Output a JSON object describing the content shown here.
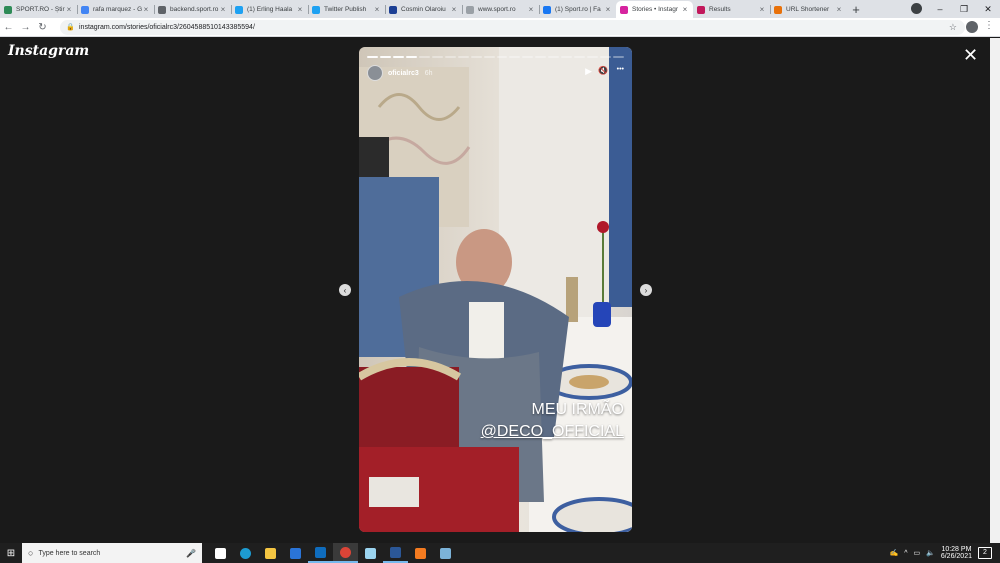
{
  "browser": {
    "tabs": [
      {
        "title": "SPORT.RO - Știri",
        "favicon_color": "#2e8b57",
        "active": false
      },
      {
        "title": "rafa marquez - G",
        "favicon_color": "#4285f4",
        "active": false
      },
      {
        "title": "backend.sport.ro",
        "favicon_color": "#5f6368",
        "active": false
      },
      {
        "title": "(1) Erling Haala",
        "favicon_color": "#1da1f2",
        "active": false
      },
      {
        "title": "Twitter Publish",
        "favicon_color": "#1da1f2",
        "active": false
      },
      {
        "title": "Cosmin Olaroiu",
        "favicon_color": "#1c3f94",
        "active": false
      },
      {
        "title": "www.sport.ro",
        "favicon_color": "#9aa0a6",
        "active": false
      },
      {
        "title": "(1) Sport.ro | Fa",
        "favicon_color": "#1877f2",
        "active": false
      },
      {
        "title": "Stories • Instagr",
        "favicon_color": "#d6249f",
        "active": true
      },
      {
        "title": "Results",
        "favicon_color": "#c2185b",
        "active": false
      },
      {
        "title": "URL Shortener",
        "favicon_color": "#e8710a",
        "active": false
      }
    ],
    "tab_close": "×",
    "new_tab": "+",
    "window_controls": {
      "minimize": "–",
      "maximize": "❐",
      "close": "✕"
    },
    "nav": {
      "back": "←",
      "forward": "→",
      "reload": "↻"
    },
    "lock_icon": "🔒",
    "url": "instagram.com/stories/oficialrc3/2604588510143385594/",
    "bookmark": "☆",
    "menu": "⋮"
  },
  "instagram": {
    "logo": "Instagram",
    "close": "✕",
    "prev": "‹",
    "next": "›",
    "story": {
      "username": "oficialrc3",
      "time": "6h",
      "play_icon": "▶",
      "mute_icon": "🔇",
      "more_icon": "•••",
      "segments_total": 20,
      "segments_done": 4,
      "caption_line1": "MEU IRMÃO",
      "caption_line2": "@DECO_OFFICIAL"
    }
  },
  "taskbar": {
    "start_icon": "⊞",
    "search_icon": "○",
    "search_placeholder": "Type here to search",
    "mic_icon": "🎤",
    "apps": [
      {
        "name": "task-view",
        "color": "#ffffff",
        "state": "idle"
      },
      {
        "name": "edge",
        "color": "#1d9bd1",
        "state": "idle"
      },
      {
        "name": "file-explorer",
        "color": "#f4c542",
        "state": "idle"
      },
      {
        "name": "mail",
        "color": "#2a74d8",
        "state": "idle"
      },
      {
        "name": "outlook",
        "color": "#0f6cbd",
        "state": "running"
      },
      {
        "name": "chrome",
        "color": "#db4437",
        "state": "active"
      },
      {
        "name": "notepad",
        "color": "#9bd4f0",
        "state": "idle"
      },
      {
        "name": "word",
        "color": "#2b5797",
        "state": "running"
      },
      {
        "name": "vlc",
        "color": "#f47b20",
        "state": "idle"
      },
      {
        "name": "paint",
        "color": "#7cb3d9",
        "state": "idle"
      }
    ],
    "tray": {
      "pen_icon": "✍",
      "chevron": "^",
      "network": "▭",
      "volume": "🔈",
      "time": "10:28 PM",
      "date": "6/26/2021",
      "notifications": "2"
    }
  }
}
